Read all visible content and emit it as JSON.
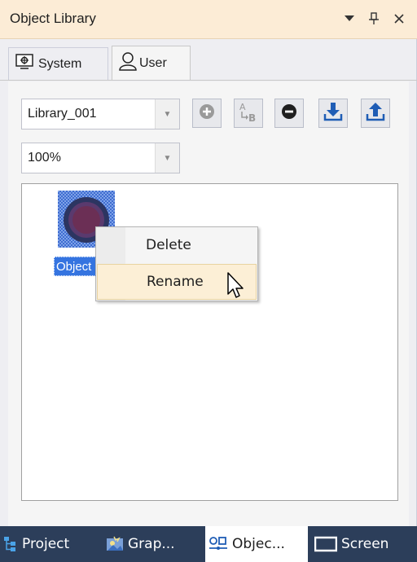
{
  "panel": {
    "title": "Object Library",
    "title_actions": [
      "dropdown-icon",
      "pin-icon",
      "close-icon"
    ]
  },
  "tabs": [
    {
      "label": "System",
      "icon": "system-icon",
      "active": false
    },
    {
      "label": "User",
      "icon": "user-icon",
      "active": true
    }
  ],
  "toolbar": {
    "library_select": "Library_001",
    "zoom_select": "100%",
    "buttons": [
      "add-icon",
      "rename-icon",
      "remove-icon",
      "import-icon",
      "export-icon"
    ]
  },
  "canvas": {
    "object_label": "Object"
  },
  "context_menu": {
    "items": [
      "Delete",
      "Rename"
    ],
    "hovered": "Rename"
  },
  "bottom_tabs": [
    {
      "label": "Project",
      "icon": "project-icon"
    },
    {
      "label": "Grap...",
      "icon": "graphics-icon"
    },
    {
      "label": "Objec...",
      "icon": "object-icon",
      "active": true
    },
    {
      "label": "Screen",
      "icon": "screen-icon"
    }
  ],
  "colors": {
    "title_bg": "#fcecd6",
    "accent": "#3574e0",
    "bottom_bar": "#2c3e5a",
    "icon_blue": "#1f5db5"
  }
}
